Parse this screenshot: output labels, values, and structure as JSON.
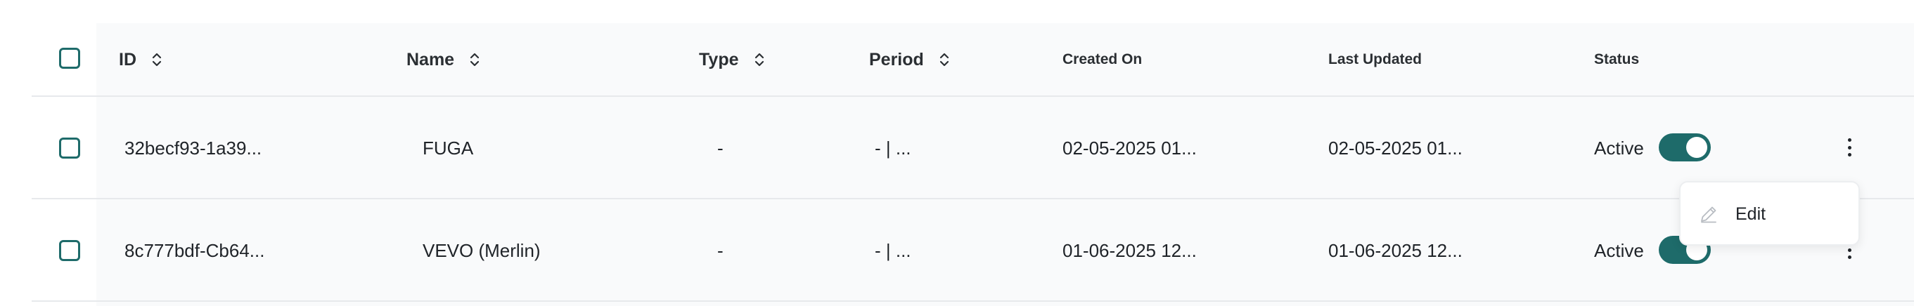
{
  "header": {
    "columns": [
      {
        "label": "ID",
        "sortable": true
      },
      {
        "label": "Name",
        "sortable": true
      },
      {
        "label": "Type",
        "sortable": true
      },
      {
        "label": "Period",
        "sortable": true
      },
      {
        "label": "Created On",
        "sortable": false
      },
      {
        "label": "Last Updated",
        "sortable": false
      },
      {
        "label": "Status",
        "sortable": false
      }
    ]
  },
  "rows": [
    {
      "id": "32becf93-1a39...",
      "name": "FUGA",
      "type": "-",
      "period": "- | ...",
      "created_on": "02-05-2025 01...",
      "last_updated": "02-05-2025 01...",
      "status": "Active",
      "status_on": true
    },
    {
      "id": "8c777bdf-Cb64...",
      "name": "VEVO (Merlin)",
      "type": "-",
      "period": "- | ...",
      "created_on": "01-06-2025 12...",
      "last_updated": "01-06-2025 12...",
      "status": "Active",
      "status_on": true
    }
  ],
  "row_menu": {
    "items": [
      {
        "label": "Edit",
        "icon": "pencil-icon"
      }
    ]
  },
  "colors": {
    "accent": "#1e6b6a",
    "table_bg": "#f9fafb",
    "divider": "#e7e9ec"
  }
}
